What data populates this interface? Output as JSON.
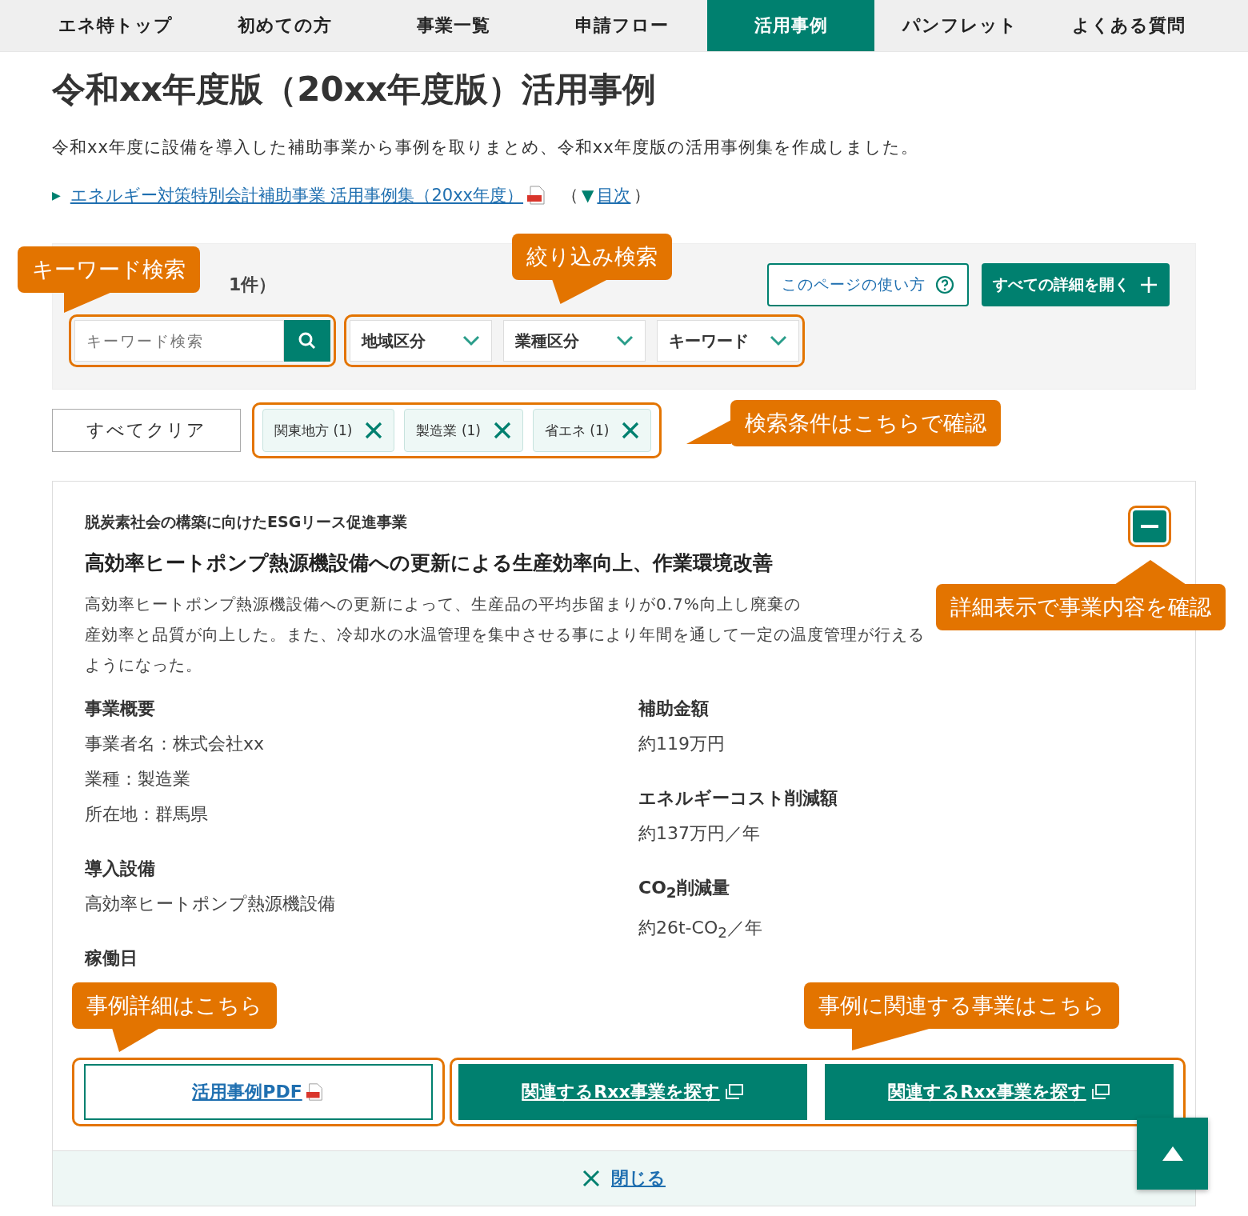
{
  "nav": [
    {
      "label": "エネ特トップ",
      "selected": false
    },
    {
      "label": "初めての方",
      "selected": false
    },
    {
      "label": "事業一覧",
      "selected": false
    },
    {
      "label": "申請フロー",
      "selected": false
    },
    {
      "label": "活用事例",
      "selected": true
    },
    {
      "label": "パンフレット",
      "selected": false
    },
    {
      "label": "よくある質問",
      "selected": false
    }
  ],
  "title": "令和xx年度版（20xx年度版）活用事例",
  "intro": "令和xx年度に設備を導入した補助事業から事例を取りまとめ、令和xx年度版の活用事例集を作成しました。",
  "doc_link": {
    "marker": "▶",
    "label": "エネルギー対策特別会計補助事業 活用事例集（20xx年度）",
    "toc_open": "（",
    "toc_marker": "▼",
    "toc_label": "目次",
    "toc_close": "）"
  },
  "filter_panel": {
    "count_heading": "1件）",
    "help_button": "このページの使い方",
    "expand_all_button": "すべての詳細を開く",
    "search": {
      "placeholder": "キーワード検索"
    },
    "dropdowns": [
      {
        "label": "地域区分"
      },
      {
        "label": "業種区分"
      },
      {
        "label": "キーワード"
      }
    ]
  },
  "clear_button": "すべてクリア",
  "chips": [
    {
      "label": "関東地方 (1)"
    },
    {
      "label": "製造業 (1)"
    },
    {
      "label": "省エネ (1)"
    }
  ],
  "case": {
    "expanded": true,
    "program": "脱炭素社会の構築に向けたESGリース促進事業",
    "title": "高効率ヒートポンプ熱源機設備への更新による生産効率向上、作業環境改善",
    "description_lines": [
      "高効率ヒートポンプ熱源機設備への更新によって、生産品の平均歩留まりが0.7%向上し廃棄の",
      "産効率と品質が向上した。また、冷却水の水温管理を集中させる事により年間を通して一定の温度管理が行える",
      "ようになった。"
    ],
    "left": [
      {
        "heading": "事業概要",
        "lines": [
          "事業者名：株式会社xx",
          "業種：製造業",
          "所在地：群馬県"
        ]
      },
      {
        "heading": "導入設備",
        "lines": [
          "高効率ヒートポンプ熱源機設備"
        ]
      },
      {
        "heading": "稼働日"
      }
    ],
    "right": [
      {
        "heading": "補助金額",
        "lines": [
          "約119万円"
        ]
      },
      {
        "heading": "エネルギーコスト削減額",
        "lines": [
          "約137万円／年"
        ]
      },
      {
        "heading": "CO$_{2}$削減量",
        "lines": [
          "約26t-CO$_{2}$／年"
        ]
      }
    ],
    "pdf_button": "活用事例PDF",
    "related_buttons": [
      "関連するRxx事業を探す",
      "関連するRxx事業を探す"
    ],
    "close_label": "閉じる"
  },
  "callouts": [
    {
      "text": "キーワード検索"
    },
    {
      "text": "絞り込み検索"
    },
    {
      "text": "検索条件はこちらで確認"
    },
    {
      "text": "詳細表示で事業内容を確認"
    },
    {
      "text": "事例詳細はこちら"
    },
    {
      "text": "事例に関連する事業はこちら"
    }
  ]
}
